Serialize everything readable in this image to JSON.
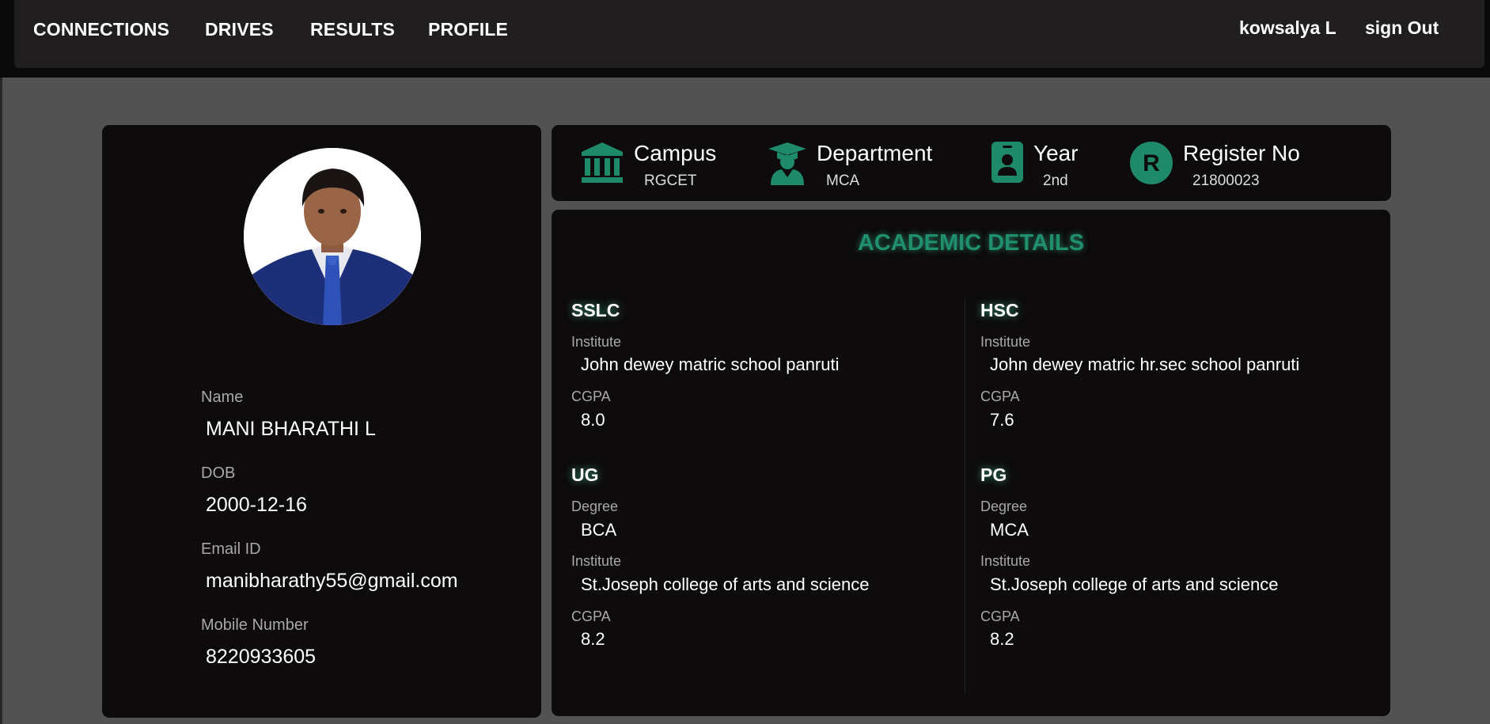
{
  "nav": {
    "links": [
      "CONNECTIONS",
      "DRIVES",
      "RESULTS",
      "PROFILE"
    ],
    "user_name": "kowsalya L",
    "sign_out": "sign Out"
  },
  "profile": {
    "name_label": "Name",
    "name": "MANI BHARATHI L",
    "dob_label": "DOB",
    "dob": "2000-12-16",
    "email_label": "Email ID",
    "email": "manibharathy55@gmail.com",
    "mobile_label": "Mobile Number",
    "mobile": "8220933605"
  },
  "info": {
    "campus": {
      "title": "Campus",
      "value": "RGCET",
      "icon": "institution-icon"
    },
    "department": {
      "title": "Department",
      "value": "MCA",
      "icon": "graduate-icon"
    },
    "year": {
      "title": "Year",
      "value": "2nd",
      "icon": "id-badge-icon"
    },
    "register": {
      "title": "Register No",
      "value": "21800023",
      "icon": "registered-icon",
      "icon_letter": "R"
    }
  },
  "academic": {
    "title": "ACADEMIC DETAILS",
    "sslc": {
      "heading": "SSLC",
      "institute_label": "Institute",
      "institute": "John dewey matric school panruti",
      "cgpa_label": "CGPA",
      "cgpa": "8.0"
    },
    "hsc": {
      "heading": "HSC",
      "institute_label": "Institute",
      "institute": "John dewey matric hr.sec school panruti",
      "cgpa_label": "CGPA",
      "cgpa": "7.6"
    },
    "ug": {
      "heading": "UG",
      "degree_label": "Degree",
      "degree": "BCA",
      "institute_label": "Institute",
      "institute": "St.Joseph college of arts and science",
      "cgpa_label": "CGPA",
      "cgpa": "8.2"
    },
    "pg": {
      "heading": "PG",
      "degree_label": "Degree",
      "degree": "MCA",
      "institute_label": "Institute",
      "institute": "St.Joseph college of arts and science",
      "cgpa_label": "CGPA",
      "cgpa": "8.2"
    }
  },
  "colors": {
    "accent": "#1f8f6e",
    "icon_green": "#1e8a6a",
    "card_bg": "#0d0b0b",
    "page_bg": "#535252",
    "topbar_bg": "#201e1f"
  }
}
